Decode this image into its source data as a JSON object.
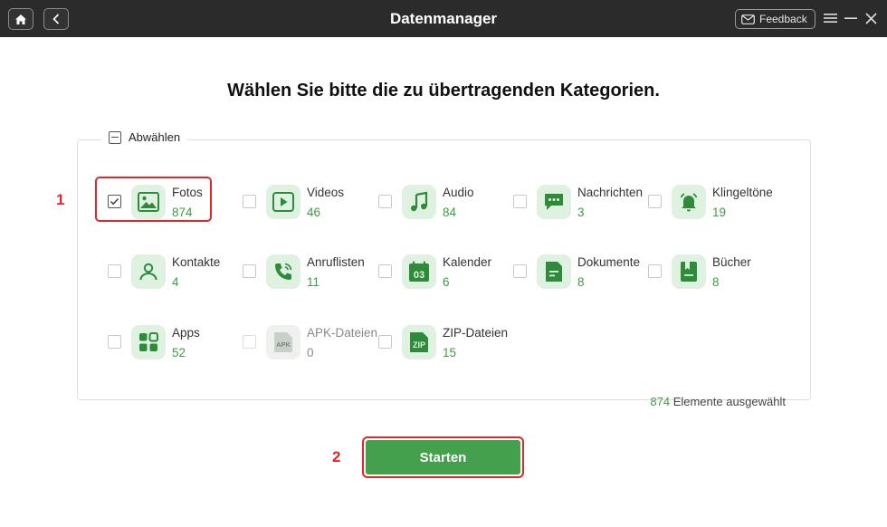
{
  "window": {
    "title": "Datenmanager",
    "feedback_label": "Feedback"
  },
  "heading": "Wählen Sie bitte die zu übertragenden Kategorien.",
  "deselect_label": "Abwählen",
  "categories": [
    {
      "name": "Fotos",
      "count": "874",
      "checked": true,
      "icon": "photo-icon"
    },
    {
      "name": "Videos",
      "count": "46",
      "checked": false,
      "icon": "video-play-icon"
    },
    {
      "name": "Audio",
      "count": "84",
      "checked": false,
      "icon": "music-note-icon"
    },
    {
      "name": "Nachrichten",
      "count": "3",
      "checked": false,
      "icon": "chat-bubble-icon"
    },
    {
      "name": "Klingeltöne",
      "count": "19",
      "checked": false,
      "icon": "bell-icon"
    },
    {
      "name": "Kontakte",
      "count": "4",
      "checked": false,
      "icon": "person-icon"
    },
    {
      "name": "Anruflisten",
      "count": "11",
      "checked": false,
      "icon": "phone-icon"
    },
    {
      "name": "Kalender",
      "count": "6",
      "checked": false,
      "icon": "calendar-icon",
      "icon_text": "03"
    },
    {
      "name": "Dokumente",
      "count": "8",
      "checked": false,
      "icon": "document-icon"
    },
    {
      "name": "Bücher",
      "count": "8",
      "checked": false,
      "icon": "book-icon"
    },
    {
      "name": "Apps",
      "count": "52",
      "checked": false,
      "icon": "apps-grid-icon"
    },
    {
      "name": "APK-Dateien",
      "count": "0",
      "checked": false,
      "disabled": true,
      "icon": "apk-file-icon",
      "icon_text": "APK"
    },
    {
      "name": "ZIP-Dateien",
      "count": "15",
      "checked": false,
      "icon": "zip-file-icon",
      "icon_text": "ZIP"
    }
  ],
  "selection": {
    "count": "874",
    "label": "Elemente ausgewählt"
  },
  "start_label": "Starten",
  "annotations": {
    "step1": "1",
    "step2": "2"
  },
  "colors": {
    "accent_green": "#44a04c",
    "highlight_red": "#e0262b",
    "titlebar": "#2b2b2b"
  }
}
